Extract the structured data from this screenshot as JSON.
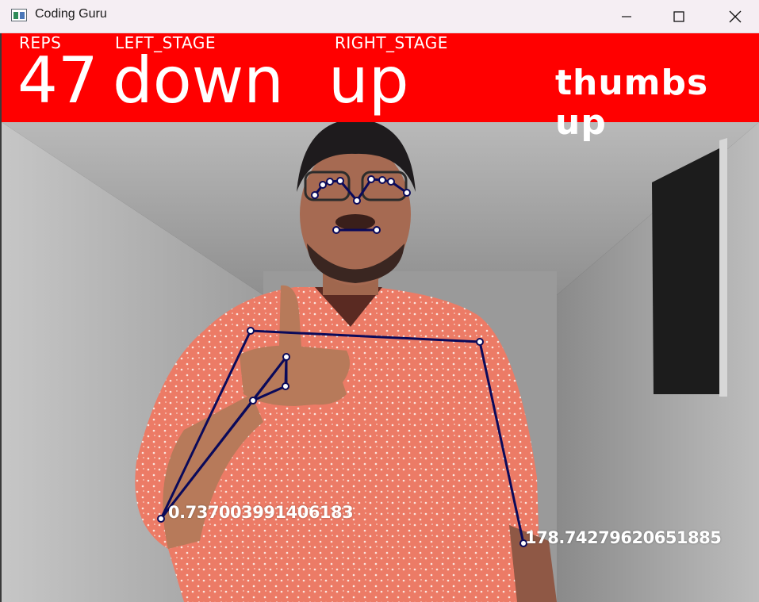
{
  "window": {
    "title": "Coding Guru",
    "minimize_icon": "minimize-icon",
    "maximize_icon": "maximize-icon",
    "close_icon": "close-icon"
  },
  "overlay": {
    "reps_label": "REPS",
    "left_stage_label": "LEFT_STAGE",
    "right_stage_label": "RIGHT_STAGE",
    "reps_value": "47",
    "left_stage_value": "down",
    "right_stage_value": "up",
    "gesture": "thumbs up",
    "banner_color": "#ff0000"
  },
  "angles": {
    "left_elbow": "0.737003991406183",
    "right_elbow": "178.74279620651885"
  },
  "colors": {
    "skeleton_line": "#0a0a5a",
    "joint_fill": "#ffffff"
  }
}
